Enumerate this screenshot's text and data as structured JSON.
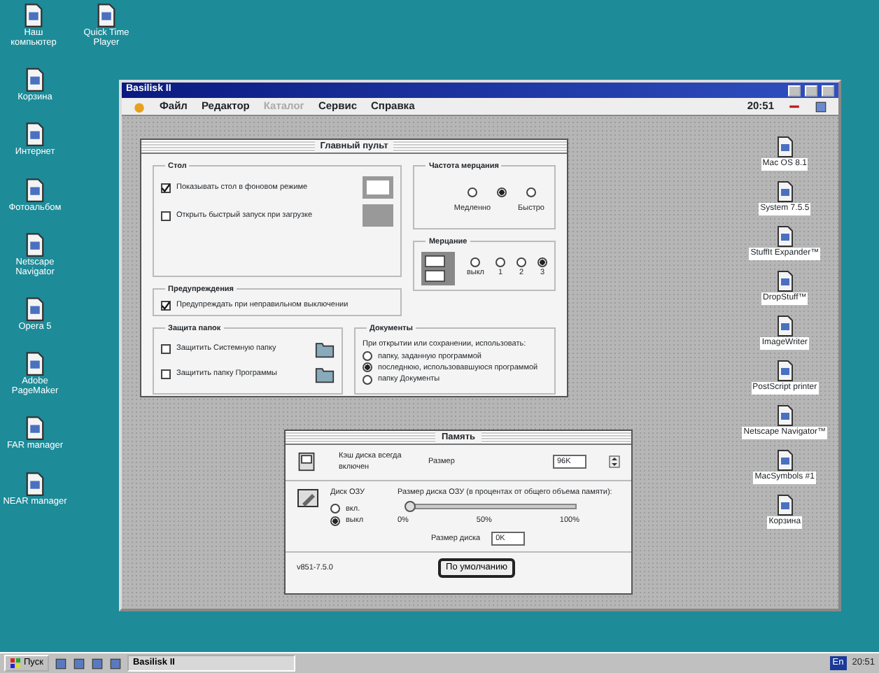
{
  "desktop_icons": [
    {
      "label": "Наш компьютер"
    },
    {
      "label": "Quick Time Player"
    },
    {
      "label": "Корзина"
    },
    {
      "label": "Интернет"
    },
    {
      "label": "Фотоальбом"
    },
    {
      "label": "Netscape Navigator"
    },
    {
      "label": "Opera 5"
    },
    {
      "label": "Adobe PageMaker"
    },
    {
      "label": "FAR manager"
    },
    {
      "label": "NEAR manager"
    }
  ],
  "emulator_window": {
    "title": "Basilisk II",
    "menu": [
      {
        "label": "Файл",
        "disabled": false
      },
      {
        "label": "Редактор",
        "disabled": false
      },
      {
        "label": "Каталог",
        "disabled": true
      },
      {
        "label": "Сервис",
        "disabled": false
      },
      {
        "label": "Справка",
        "disabled": false
      }
    ],
    "clock": "20:51"
  },
  "mac_desktop_icons": [
    {
      "label": "Mac OS 8.1"
    },
    {
      "label": "System 7.5.5"
    },
    {
      "label": "StuffIt Expander™"
    },
    {
      "label": "DropStuff™"
    },
    {
      "label": "ImageWriter"
    },
    {
      "label": "PostScript printer"
    },
    {
      "label": "Netscape Navigator™"
    },
    {
      "label": "MacSymbols #1"
    },
    {
      "label": "Корзина"
    }
  ],
  "control_panel": {
    "title": "Главный пульт",
    "desktop": {
      "title": "Стол",
      "options": [
        {
          "label": "Показывать стол в фоновом режиме",
          "checked": true
        },
        {
          "label": "Открыть быстрый запуск при загрузке",
          "checked": false
        }
      ]
    },
    "warnings": {
      "title": "Предупреждения",
      "options": [
        {
          "label": "Предупреждать при неправильном выключении",
          "checked": true
        }
      ]
    },
    "folder_protection": {
      "title": "Защита папок",
      "options": [
        {
          "label": "Защитить Системную папку",
          "checked": false
        },
        {
          "label": "Защитить папку Программы",
          "checked": false
        }
      ]
    },
    "blink_rate": {
      "title": "Частота мерцания",
      "options": [
        {
          "label": "Медленно",
          "selected": false
        },
        {
          "selected": true
        },
        {
          "label": "Быстро",
          "selected": false
        }
      ]
    },
    "menu_blink": {
      "title": "Мерцание",
      "options": [
        {
          "label": "выкл",
          "selected": false
        },
        {
          "label": "1",
          "selected": false
        },
        {
          "label": "2",
          "selected": false
        },
        {
          "label": "3",
          "selected": true
        }
      ]
    },
    "documents": {
      "title": "Документы",
      "prompt": "При открытии или сохранении, использовать:",
      "options": [
        {
          "label": "папку, заданную программой",
          "selected": false
        },
        {
          "label": "последнюю, использовавшуюся программой",
          "selected": true
        },
        {
          "label": "папку Документы",
          "selected": false
        }
      ]
    }
  },
  "memory_dialog": {
    "title": "Память",
    "disk_cache": {
      "label": "Кэш диска всегда включен",
      "size_label": "Размер",
      "size_value": "96K"
    },
    "ram_disk": {
      "title": "Диск ОЗУ",
      "options": [
        {
          "label": "вкл.",
          "selected": false
        },
        {
          "label": "выкл",
          "selected": true
        }
      ],
      "size_caption": "Размер диска ОЗУ (в процентах от общего объема памяти):",
      "slider": {
        "level": 0
      },
      "ticks": [
        "0%",
        "50%",
        "100%"
      ],
      "disk_size_label": "Размер диска",
      "disk_size_value": "0K"
    },
    "default_button": "По умолчанию",
    "version": "v851-7.5.0"
  },
  "taskbar": {
    "start": "Пуск",
    "tasks": [
      {
        "label": "Basilisk II",
        "selected": true
      }
    ],
    "language": "En",
    "clock": "20:51"
  }
}
